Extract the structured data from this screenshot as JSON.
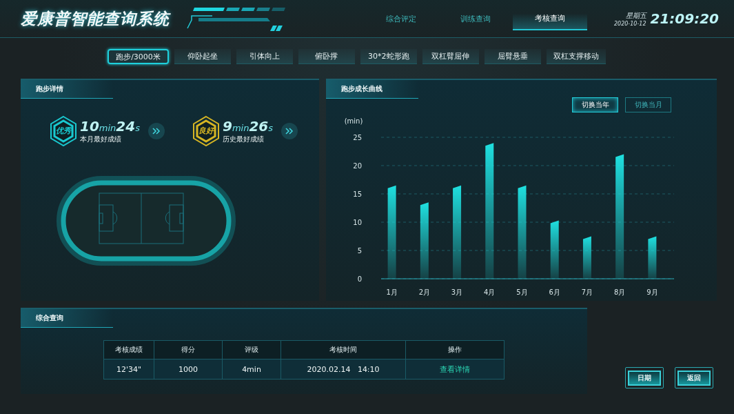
{
  "header": {
    "title": "爱康普智能查询系统",
    "nav": [
      {
        "label": "综合评定",
        "selected": false
      },
      {
        "label": "训练查询",
        "selected": false
      },
      {
        "label": "考核查询",
        "selected": true
      }
    ],
    "weekday": "星期五",
    "date": "2020-10-12",
    "time": "21:09:20"
  },
  "events": [
    {
      "label": "跑步/3000米",
      "selected": true
    },
    {
      "label": "仰卧起坐",
      "selected": false
    },
    {
      "label": "引体向上",
      "selected": false
    },
    {
      "label": "俯卧撑",
      "selected": false
    },
    {
      "label": "30*2蛇形跑",
      "selected": false
    },
    {
      "label": "双杠臂屈伸",
      "selected": false
    },
    {
      "label": "屈臂悬垂",
      "selected": false
    },
    {
      "label": "双杠支撑移动",
      "selected": false
    }
  ],
  "details": {
    "title": "跑步详情",
    "records": [
      {
        "grade": "优秀",
        "color": "#19c9d0",
        "minutes": "10",
        "min_unit": "min",
        "seconds": "24",
        "sec_unit": "s",
        "caption": "本月最好成绩"
      },
      {
        "grade": "良好",
        "color": "#d6b523",
        "minutes": "9",
        "min_unit": "min",
        "seconds": "26",
        "sec_unit": "s",
        "caption": "历史最好成绩"
      }
    ]
  },
  "growth": {
    "title": "跑步成长曲线",
    "toggles": [
      {
        "label": "切换当年",
        "selected": true
      },
      {
        "label": "切换当月",
        "selected": false
      }
    ],
    "chart_data": {
      "type": "bar",
      "ylabel": "(min)",
      "categories": [
        "1月",
        "2月",
        "3月",
        "4月",
        "5月",
        "6月",
        "7月",
        "8月",
        "9月"
      ],
      "grid": true,
      "series": [
        {
          "color": "#1fe0e0",
          "values": [
            16.5,
            13.5,
            16.5,
            24,
            16.5,
            10.3,
            7.5,
            22,
            7.5
          ]
        }
      ],
      "ylim": [
        0,
        25
      ],
      "yticks": [
        0,
        5,
        10,
        15,
        20,
        25
      ]
    }
  },
  "summary": {
    "title": "综合查询",
    "table": {
      "columns": [
        "考核成绩",
        "得分",
        "评级",
        "考核时间",
        "操作"
      ],
      "rows": [
        [
          "12'34\"",
          "1000",
          "4min",
          "2020.02.14   14:10",
          "查看详情"
        ]
      ]
    }
  },
  "buttons": [
    "日期",
    "返回"
  ]
}
